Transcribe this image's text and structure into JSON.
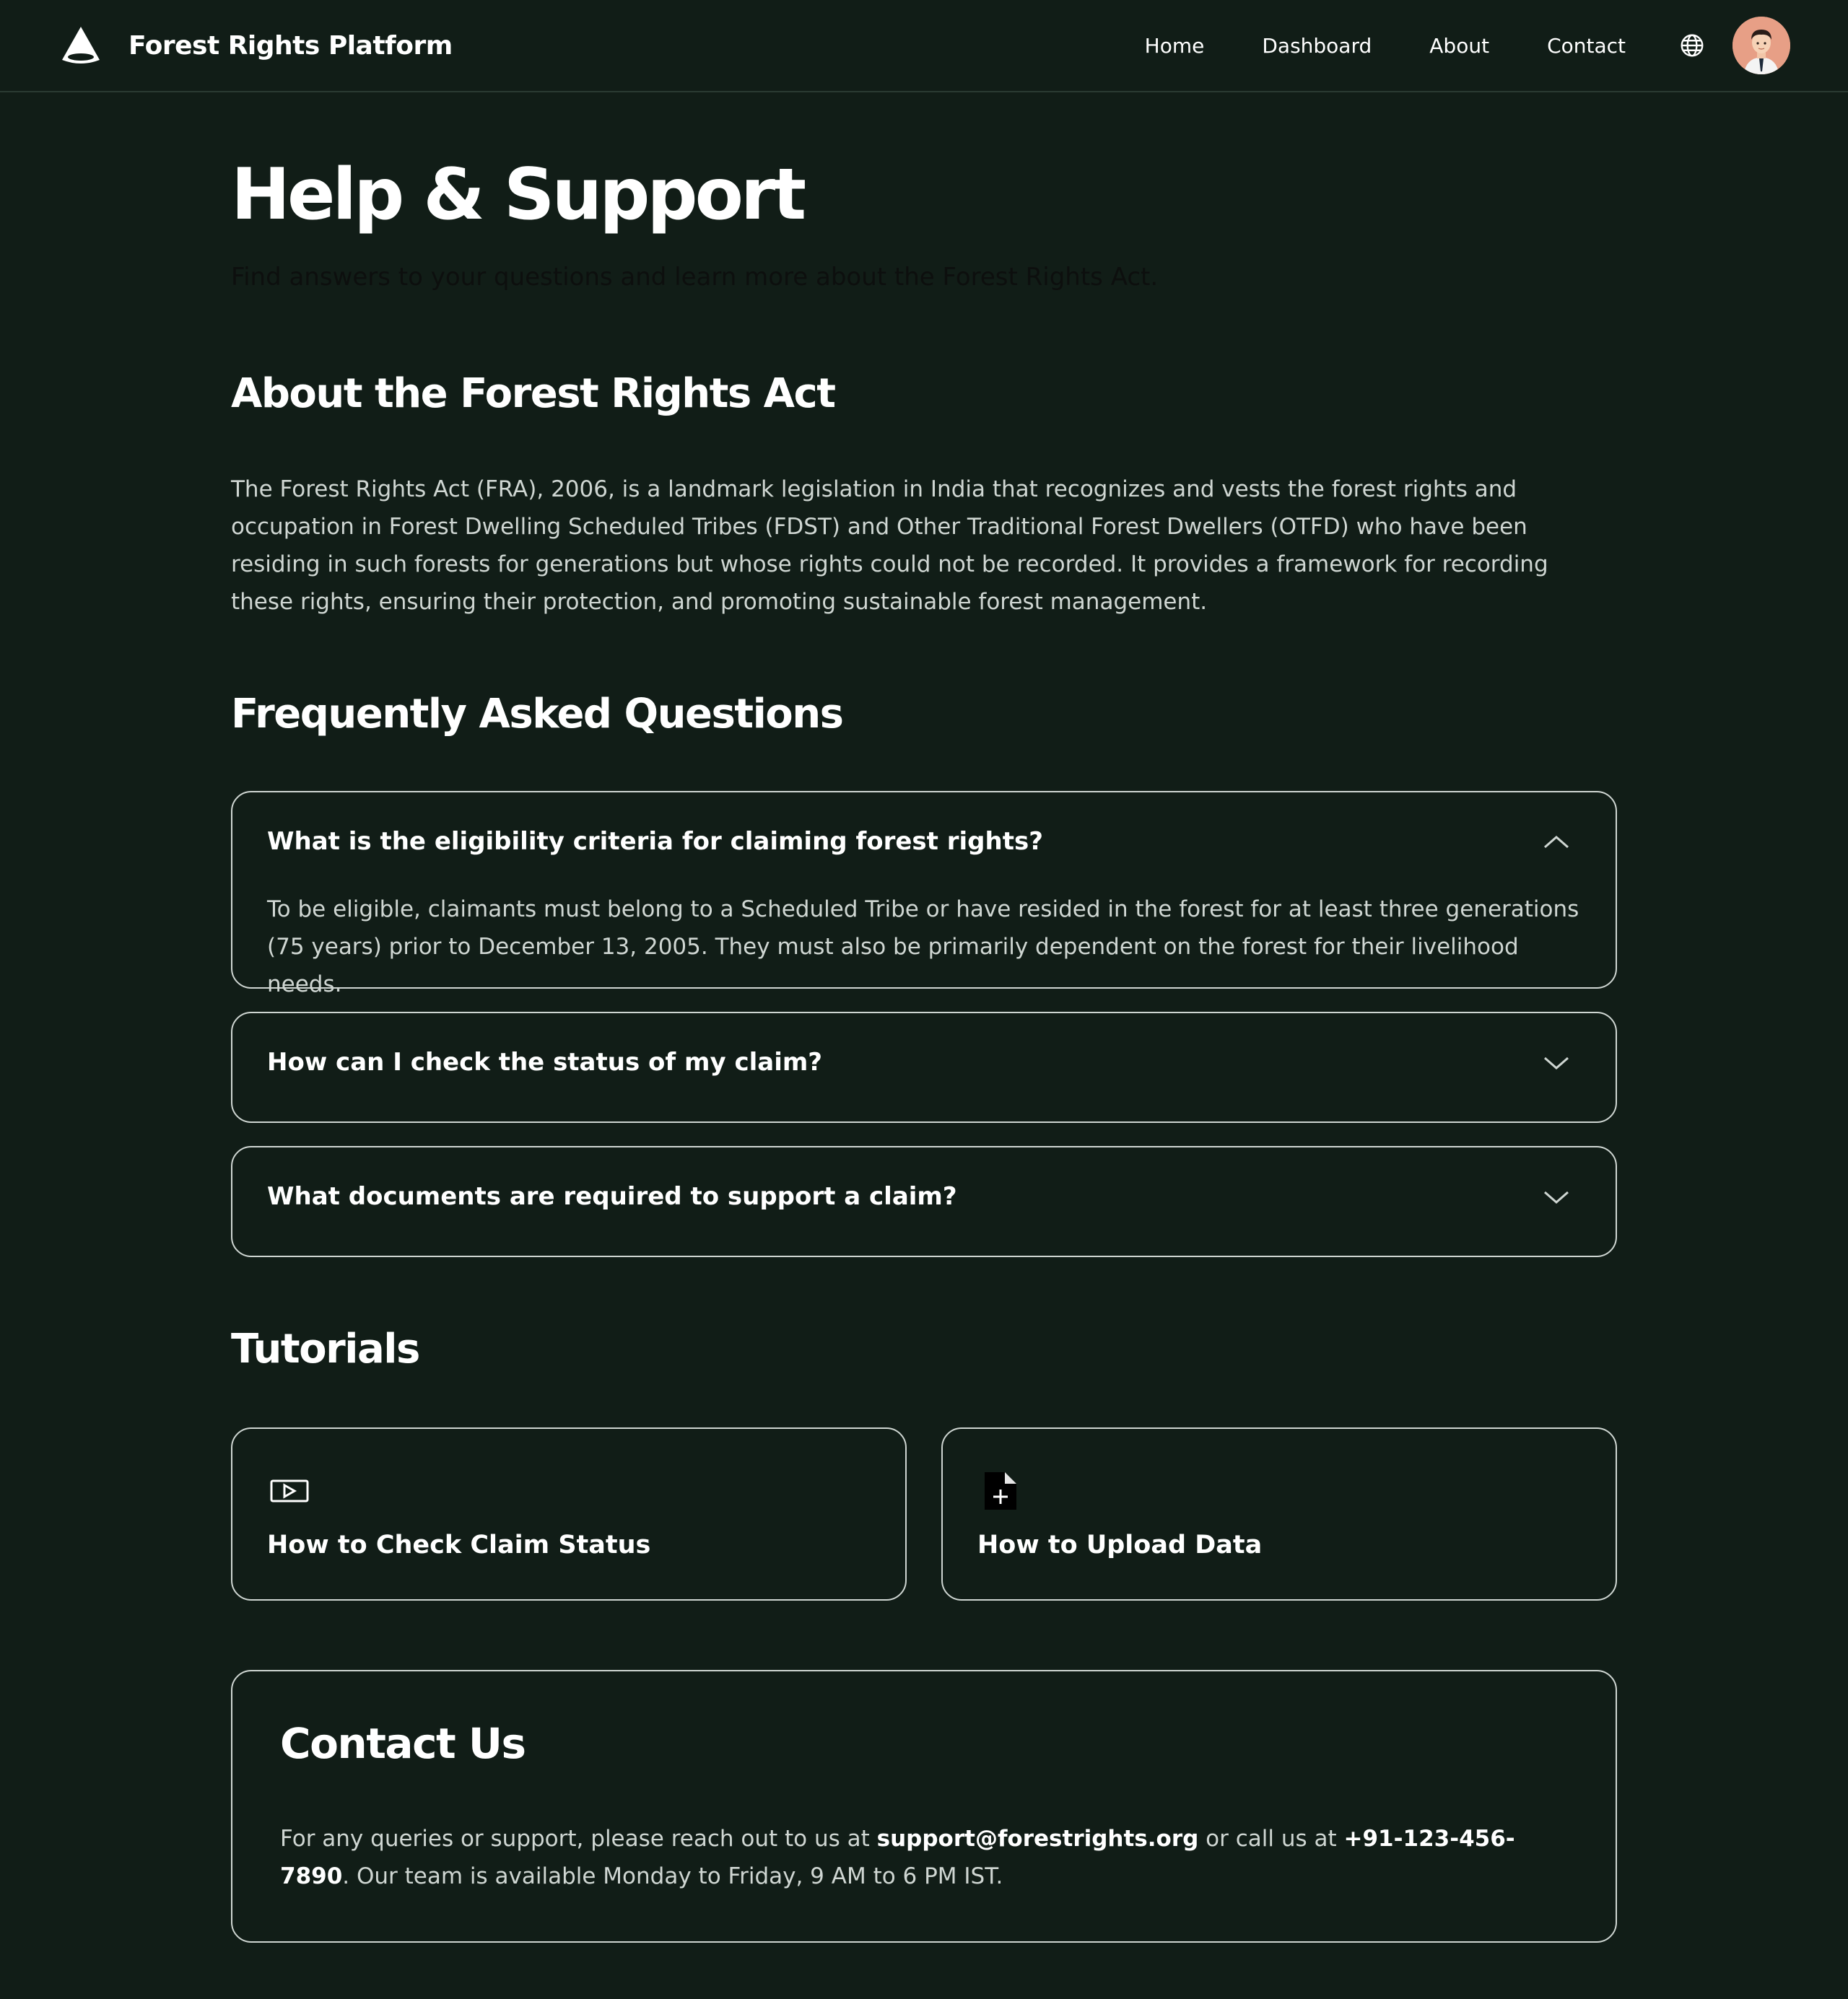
{
  "header": {
    "brand": "Forest Rights Platform",
    "logo_icon": "tent-icon",
    "nav": [
      "Home",
      "Dashboard",
      "About",
      "Contact"
    ],
    "language_icon": "globe-icon",
    "avatar_icon": "user-avatar"
  },
  "page": {
    "title": "Help & Support",
    "subtitle": "Find answers to your questions and learn more about the Forest Rights Act."
  },
  "about": {
    "heading": "About the Forest Rights Act",
    "text": "The Forest Rights Act (FRA), 2006, is a landmark legislation in India that recognizes and vests the forest rights and occupation in Forest Dwelling Scheduled Tribes (FDST) and Other Traditional Forest Dwellers (OTFD) who have been residing in such forests for generations but whose rights could not be recorded. It provides a framework for recording these rights, ensuring their protection, and promoting sustainable forest management."
  },
  "faq": {
    "heading": "Frequently Asked Questions",
    "items": [
      {
        "question": "What is the eligibility criteria for claiming forest rights?",
        "answer": "To be eligible, claimants must belong to a Scheduled Tribe or have resided in the forest for at least three generations (75 years) prior to December 13, 2005. They must also be primarily dependent on the forest for their livelihood needs.",
        "expanded": true,
        "icon": "chevron-up-icon"
      },
      {
        "question": "How can I check the status of my claim?",
        "answer": "",
        "expanded": false,
        "icon": "chevron-down-icon"
      },
      {
        "question": "What documents are required to support a claim?",
        "answer": "",
        "expanded": false,
        "icon": "chevron-down-icon"
      }
    ]
  },
  "tutorials": {
    "heading": "Tutorials",
    "items": [
      {
        "title": "How to Check Claim Status",
        "icon": "video-icon"
      },
      {
        "title": "How to Upload Data",
        "icon": "file-add-icon"
      }
    ]
  },
  "contact": {
    "heading": "Contact Us",
    "text_1": "For any queries or support, please reach out to us at ",
    "email": "support@forestrights.org",
    "text_2": " or call us at ",
    "phone": "+91-123-456-7890",
    "text_3": ". Our team is available Monday to Friday, 9 AM to 6 PM IST."
  },
  "colors": {
    "background": "#111d17",
    "border": "#cfd6d2",
    "text_muted": "#cfd6d2",
    "avatar_bg": "#e79f86"
  }
}
